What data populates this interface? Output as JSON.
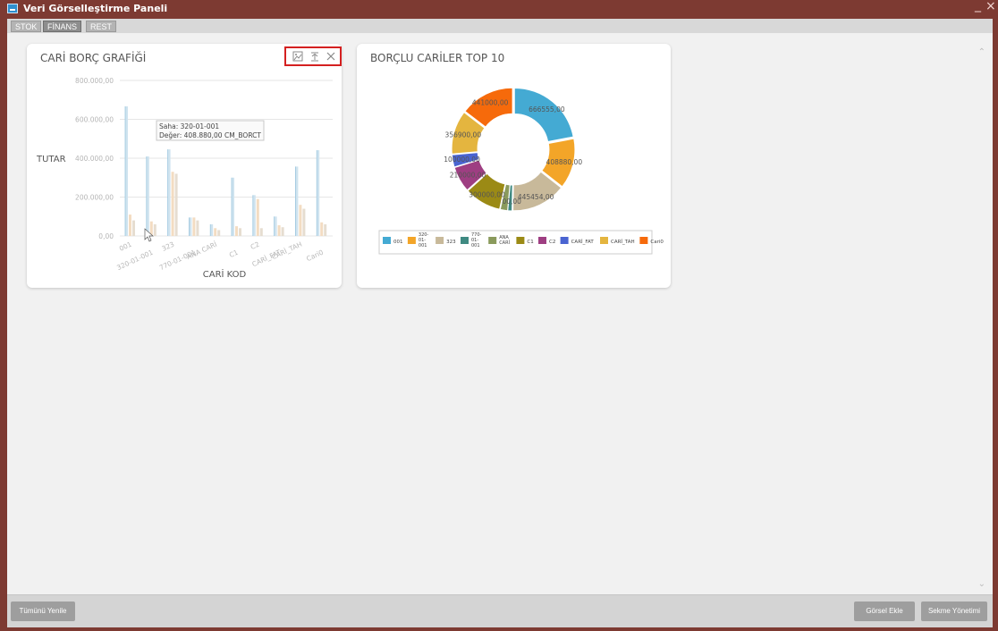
{
  "window": {
    "title": "Veri Görselleştirme Paneli",
    "minimize": "_",
    "close": "×"
  },
  "tabs": [
    {
      "label": "STOK",
      "active": false
    },
    {
      "label": "FİNANS",
      "active": true
    },
    {
      "label": "REST",
      "active": false
    }
  ],
  "bar_card": {
    "title": "CARİ BORÇ GRAFİĞİ",
    "tools": [
      "image-save-icon",
      "data-export-icon",
      "close-icon"
    ]
  },
  "pie_card": {
    "title": "BORÇLU CARİLER TOP 10"
  },
  "chart_data": [
    {
      "type": "bar",
      "title": "CARİ BORÇ GRAFİĞİ",
      "xlabel": "CARİ KOD",
      "ylabel": "TUTAR",
      "ylim": [
        0,
        800000
      ],
      "yticks": [
        "0,00",
        "200.000,00",
        "400.000,00",
        "600.000,00",
        "800.000,00"
      ],
      "categories": [
        "001",
        "320-01-001",
        "323",
        "770-01-001",
        "ANA CARİ",
        "C1",
        "C2",
        "CARİ_FAT",
        "CARİ_TAH",
        "Cari0"
      ],
      "series": [
        {
          "color": "#cfe3ef",
          "values": [
            666555,
            408880,
            445454,
            95000,
            60000,
            300000,
            210000,
            100000,
            356900,
            441000
          ]
        },
        {
          "color": "#f3dcc2",
          "values": [
            110000,
            75000,
            330000,
            95000,
            40000,
            50000,
            190000,
            55000,
            160000,
            70000
          ]
        },
        {
          "color": "#e6ddd0",
          "values": [
            80000,
            60000,
            320000,
            80000,
            30000,
            40000,
            40000,
            45000,
            140000,
            60000
          ]
        }
      ],
      "tooltip": {
        "line1": "Saha: 320-01-001",
        "line2": "Değer: 408.880,00 CM_BORCT"
      }
    },
    {
      "type": "pie",
      "title": "BORÇLU CARİLER TOP 10",
      "slices": [
        {
          "label": "001",
          "value": 666555,
          "text": "666555,00",
          "color": "#44aad3"
        },
        {
          "label": "320-01-001",
          "value": 408880,
          "text": "408880,00",
          "color": "#f3a528"
        },
        {
          "label": "323",
          "value": 445454,
          "text": "445454,00",
          "color": "#c8b99a"
        },
        {
          "label": "770-01-001",
          "value": 35000,
          "text": "",
          "color": "#3f8a82"
        },
        {
          "label": "ANA CARİ",
          "value": 60000,
          "text": "35000,00",
          "color": "#8a9a5c"
        },
        {
          "label": "C1",
          "value": 300000,
          "text": "300000,00",
          "color": "#9b8a15"
        },
        {
          "label": "C2",
          "value": 210000,
          "text": "210000,00",
          "color": "#9e3e82"
        },
        {
          "label": "CARİ_FAT",
          "value": 100000,
          "text": "100000,00",
          "color": "#4a64d1"
        },
        {
          "label": "CARİ_TAH",
          "value": 356900,
          "text": "356900,00",
          "color": "#e4b53f"
        },
        {
          "label": "Cari0",
          "value": 441000,
          "text": "441000,00",
          "color": "#f66a0b"
        }
      ],
      "legend": [
        "001",
        "320-01-001",
        "323",
        "770-01-001",
        "ANA CARİ",
        "C1",
        "C2",
        "CARİ_FAT",
        "CARİ_TAH",
        "Cari0"
      ]
    }
  ],
  "bottom": {
    "refresh_all": "Tümünü Yenile",
    "add_visual": "Görsel Ekle",
    "tab_management": "Sekme Yönetimi"
  },
  "scroll": {
    "up": "⌃",
    "down": "⌄"
  }
}
